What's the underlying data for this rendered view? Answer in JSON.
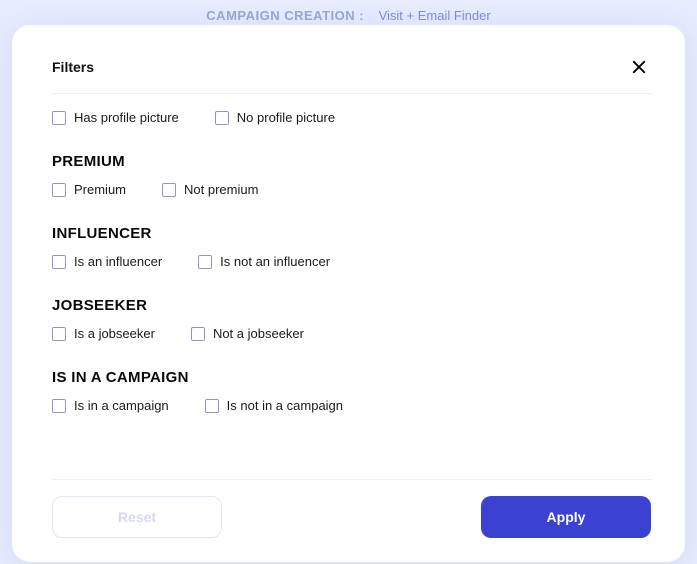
{
  "header": {
    "label": "CAMPAIGN CREATION :",
    "value": "Visit + Email Finder"
  },
  "modal": {
    "title": "Filters"
  },
  "profilePicture": {
    "has": "Has profile picture",
    "no": "No profile picture"
  },
  "premium": {
    "heading": "PREMIUM",
    "yes": "Premium",
    "no": "Not premium"
  },
  "influencer": {
    "heading": "INFLUENCER",
    "yes": "Is an influencer",
    "no": "Is not an influencer"
  },
  "jobseeker": {
    "heading": "JOBSEEKER",
    "yes": "Is a jobseeker",
    "no": "Not a jobseeker"
  },
  "campaign": {
    "heading": "IS IN A CAMPAIGN",
    "yes": "Is in a campaign",
    "no": "Is not in a campaign"
  },
  "buttons": {
    "reset": "Reset",
    "apply": "Apply"
  }
}
